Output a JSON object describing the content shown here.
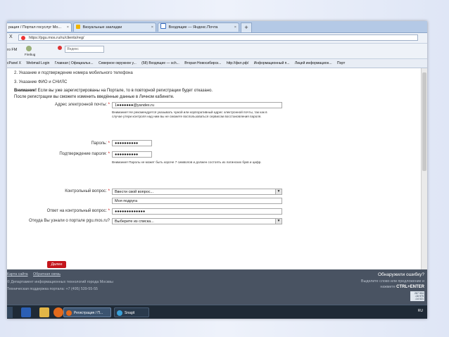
{
  "browser": {
    "tabs": [
      {
        "label": "рация / Портал госуслуг Мо...",
        "close": "×"
      },
      {
        "label": "Визуальные закладки",
        "close": "×"
      },
      {
        "label": "Входящие — Яндекс.Почта",
        "close": "×"
      }
    ],
    "new_tab": "+",
    "nav_close": "X",
    "url": "https://pgu.mos.ru/ru/clients/reg/",
    "toolbar": {
      "item1": "ro FM",
      "firebug": "Firebug",
      "yandex": "Яндекс"
    },
    "bookmarks": [
      "cPanel X",
      "Webmail Login",
      "Главная | Официальн...",
      "Северное окружное у...",
      "(58) Входящие — sch...",
      "Вторая Новосибирск...",
      "http://фкл.рф/",
      "Информационный п...",
      "Лицей информацион...",
      "Порт"
    ]
  },
  "steps": {
    "step2": "2.  Указание и подтверждение номера мобильного телефона",
    "step3": "3.  Указание ФИО и СНИЛС"
  },
  "warning": {
    "bold": "Внимание!",
    "text1": " Если вы уже зарегистрированы на Портале, то в повторной регистрации будет отказано.",
    "text2": "После регистрации вы сможете изменить введённые данные в Личном кабинете."
  },
  "form": {
    "email": {
      "label": "Адрес электронной почты:",
      "value": "1●●●●●●●@yandex.ru",
      "hint": "Внимание! Не рекомендуется указывать чужой или корпоративный адрес электронной почты, так как в случае утери контроля над ним вы не сможете воспользоваться сервисом восстановления пароля."
    },
    "password": {
      "label": "Пароль:",
      "value": "●●●●●●●●●●"
    },
    "password_confirm": {
      "label": "Подтверждение пароля:",
      "value": "●●●●●●●●●●",
      "hint": "Внимание! Пароль не может быть короче 7 символов и должен состоять из латинских букв и цифр."
    },
    "question": {
      "label": "Контрольный вопрос:",
      "selected": "Ввести свой вопрос...",
      "custom": "Моя подруга"
    },
    "answer": {
      "label": "Ответ на контрольный вопрос:",
      "value": "●●●●●●●●●●●●●"
    },
    "source": {
      "label": "Откуда Вы узнали о портале pgu.mos.ru?",
      "selected": "Выберите из списка..."
    },
    "required_mark": "*",
    "next_button": "Далее"
  },
  "footer": {
    "links": [
      "Карта сайта",
      "Обратная связь"
    ],
    "org": "© Департамент информационных технологий города Москвы",
    "support": "Техническая поддержка портала: +7 (495) 539-55-55",
    "error_title": "Обнаружили ошибку?",
    "error_hint1": "Выделите слово или предложение и",
    "error_hint2": "нажмите",
    "error_keys": "CTRL+ENTER",
    "counter": [
      "267 904",
      "↓16 975",
      "↓14 021"
    ]
  },
  "taskbar": {
    "tasks": [
      "Регистрация / П...",
      "Snagit"
    ],
    "lang": "RU"
  }
}
